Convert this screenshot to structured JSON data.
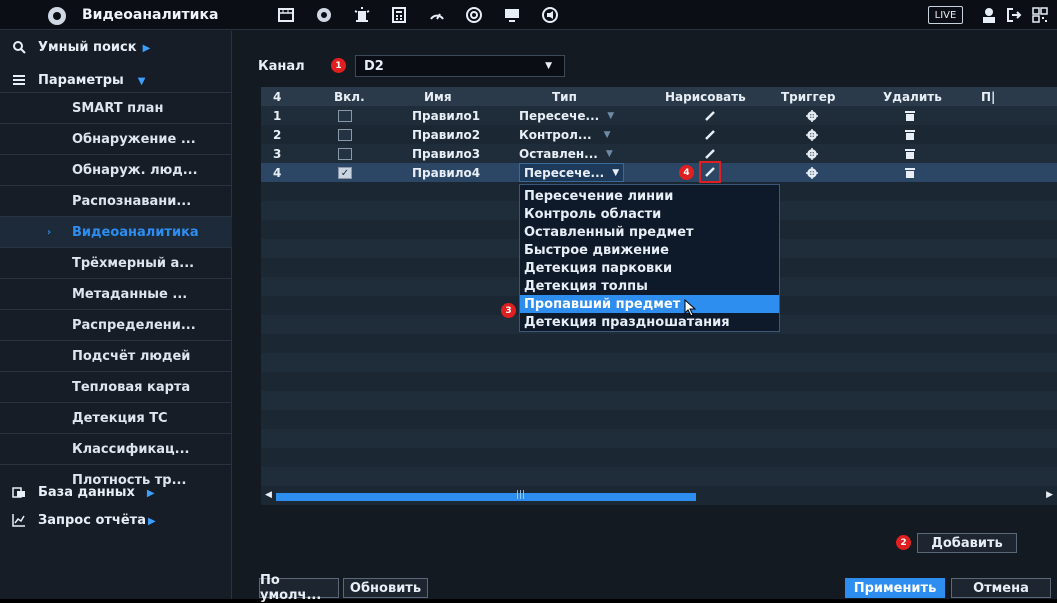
{
  "app_title": "Видеоаналитика",
  "top_icons": [
    "film-icon",
    "face-icon",
    "alarm-icon",
    "calculator-icon",
    "gauge-icon",
    "target-icon",
    "monitor-icon",
    "speaker-icon"
  ],
  "live_label": "LIVE",
  "sidebar": {
    "smart_search": "Умный поиск",
    "parameters": "Параметры",
    "items": [
      {
        "label": "SMART план"
      },
      {
        "label": "Обнаружение ..."
      },
      {
        "label": "Обнаруж. люд..."
      },
      {
        "label": "Распознавани..."
      },
      {
        "label": "Видеоаналитика",
        "active": true
      },
      {
        "label": "Трёхмерный а..."
      },
      {
        "label": "Метаданные ..."
      },
      {
        "label": "Распределени..."
      },
      {
        "label": "Подсчёт людей"
      },
      {
        "label": "Тепловая карта"
      },
      {
        "label": "Детекция ТС"
      },
      {
        "label": "Классификац..."
      },
      {
        "label": "Плотность тр..."
      }
    ],
    "database": "База данных",
    "report": "Запрос отчёта"
  },
  "channel": {
    "label": "Канал",
    "value": "D2",
    "badge": "1"
  },
  "table": {
    "headers": [
      "4",
      "Вкл.",
      "Имя",
      "Тип",
      "Нарисовать",
      "Триггер",
      "Удалить",
      "П|"
    ],
    "rows": [
      {
        "num": "1",
        "enabled": false,
        "name": "Правило1",
        "type": "Пересече..."
      },
      {
        "num": "2",
        "enabled": false,
        "name": "Правило2",
        "type": "Контрол..."
      },
      {
        "num": "3",
        "enabled": false,
        "name": "Правило3",
        "type": "Оставлен..."
      },
      {
        "num": "4",
        "enabled": true,
        "name": "Правило4",
        "type": "Пересече..."
      }
    ]
  },
  "type_options": [
    "Пересечение линии",
    "Контроль области",
    "Оставленный предмет",
    "Быстрое движение",
    "Детекция парковки",
    "Детекция толпы",
    "Пропавший предмет",
    "Детекция праздношатания"
  ],
  "highlighted_option": "Пропавший предмет",
  "badges": {
    "b2": "2",
    "b3": "3",
    "b4": "4"
  },
  "buttons": {
    "add": "Добавить",
    "default": "По умолч...",
    "refresh": "Обновить",
    "apply": "Применить",
    "cancel": "Отмена"
  },
  "colors": {
    "accent": "#2e8ef0",
    "badge": "#e02020"
  }
}
